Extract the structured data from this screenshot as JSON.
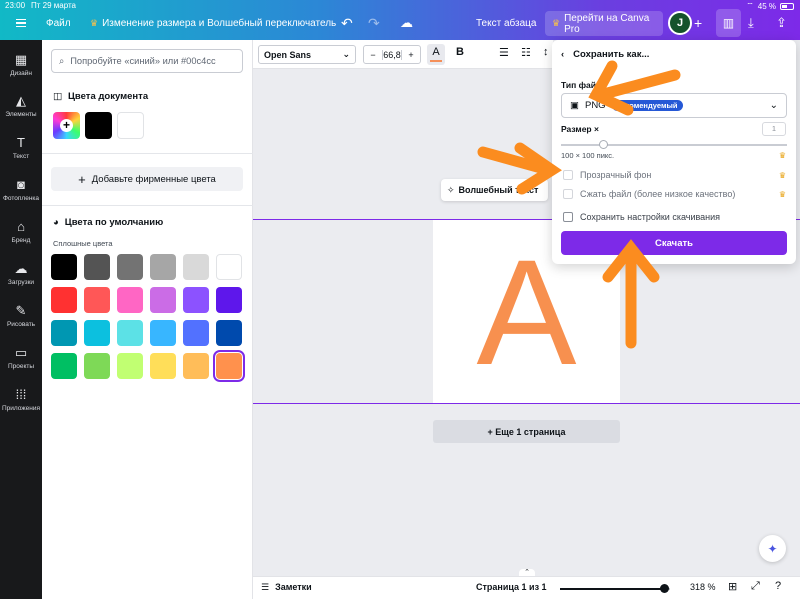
{
  "status_bar": {
    "time": "23:00",
    "date": "Пт 29 марта",
    "battery": "45 %"
  },
  "header": {
    "file_menu": "Файл",
    "doc_title": "Изменение размера и Волшебный переключатель",
    "text_label": "Текст абзаца",
    "pro_button": "Перейти на Canva Pro",
    "avatar_letter": "J"
  },
  "rail": [
    {
      "icon": "design-icon",
      "label": "Дизайн"
    },
    {
      "icon": "elements-icon",
      "label": "Элементы"
    },
    {
      "icon": "text-icon",
      "label": "Текст"
    },
    {
      "icon": "camera-icon",
      "label": "Фотопленка"
    },
    {
      "icon": "brand-icon",
      "label": "Бренд"
    },
    {
      "icon": "upload-icon",
      "label": "Загрузки"
    },
    {
      "icon": "draw-icon",
      "label": "Рисовать"
    },
    {
      "icon": "folder-icon",
      "label": "Проекты"
    },
    {
      "icon": "apps-icon",
      "label": "Приложения"
    }
  ],
  "panel": {
    "search_placeholder": "Попробуйте «синий» или #00c4cc",
    "doc_colors_title": "Цвета документа",
    "doc_colors": [
      "#000000",
      "#ffffff"
    ],
    "brand_button": "Добавьте фирменные цвета",
    "default_title": "Цвета по умолчанию",
    "solid_label": "Сплошные цвета",
    "palette": [
      "#000000",
      "#545454",
      "#737373",
      "#a6a6a6",
      "#d9d9d9",
      "#ffffff",
      "#ff3131",
      "#ff5757",
      "#ff66c4",
      "#cb6ce6",
      "#8c52ff",
      "#5e17eb",
      "#0097b2",
      "#0cc0df",
      "#5ce1e6",
      "#38b6ff",
      "#5271ff",
      "#004aad",
      "#00bf63",
      "#7ed957",
      "#c1ff72",
      "#ffde59",
      "#ffbd59",
      "#ff914d"
    ],
    "selected_color": "#ff914d"
  },
  "toolbar": {
    "font": "Open Sans",
    "size": "66,8"
  },
  "canvas": {
    "letter": "A",
    "magic_switch": "Волшебный текст",
    "more_pages": "+ Еще 1 страница"
  },
  "bottom": {
    "notes": "Заметки",
    "page_info": "Страница 1 из 1",
    "zoom": "318 %"
  },
  "download": {
    "title": "Сохранить как...",
    "file_type_label": "Тип файла",
    "file_type": "PNG",
    "recommended": "Рекомендуемый",
    "size_label": "Размер ×",
    "size_value": "1",
    "size_caption": "100 × 100 пикс.",
    "options": [
      {
        "label": "Прозрачный фон",
        "pro": true
      },
      {
        "label": "Сжать файл (более низкое качество)",
        "pro": true
      },
      {
        "label": "Сохранить настройки скачивания",
        "pro": false
      }
    ],
    "button": "Скачать"
  },
  "colors": {
    "accent": "#7d2ae8",
    "arrow": "#fb8c1f"
  }
}
